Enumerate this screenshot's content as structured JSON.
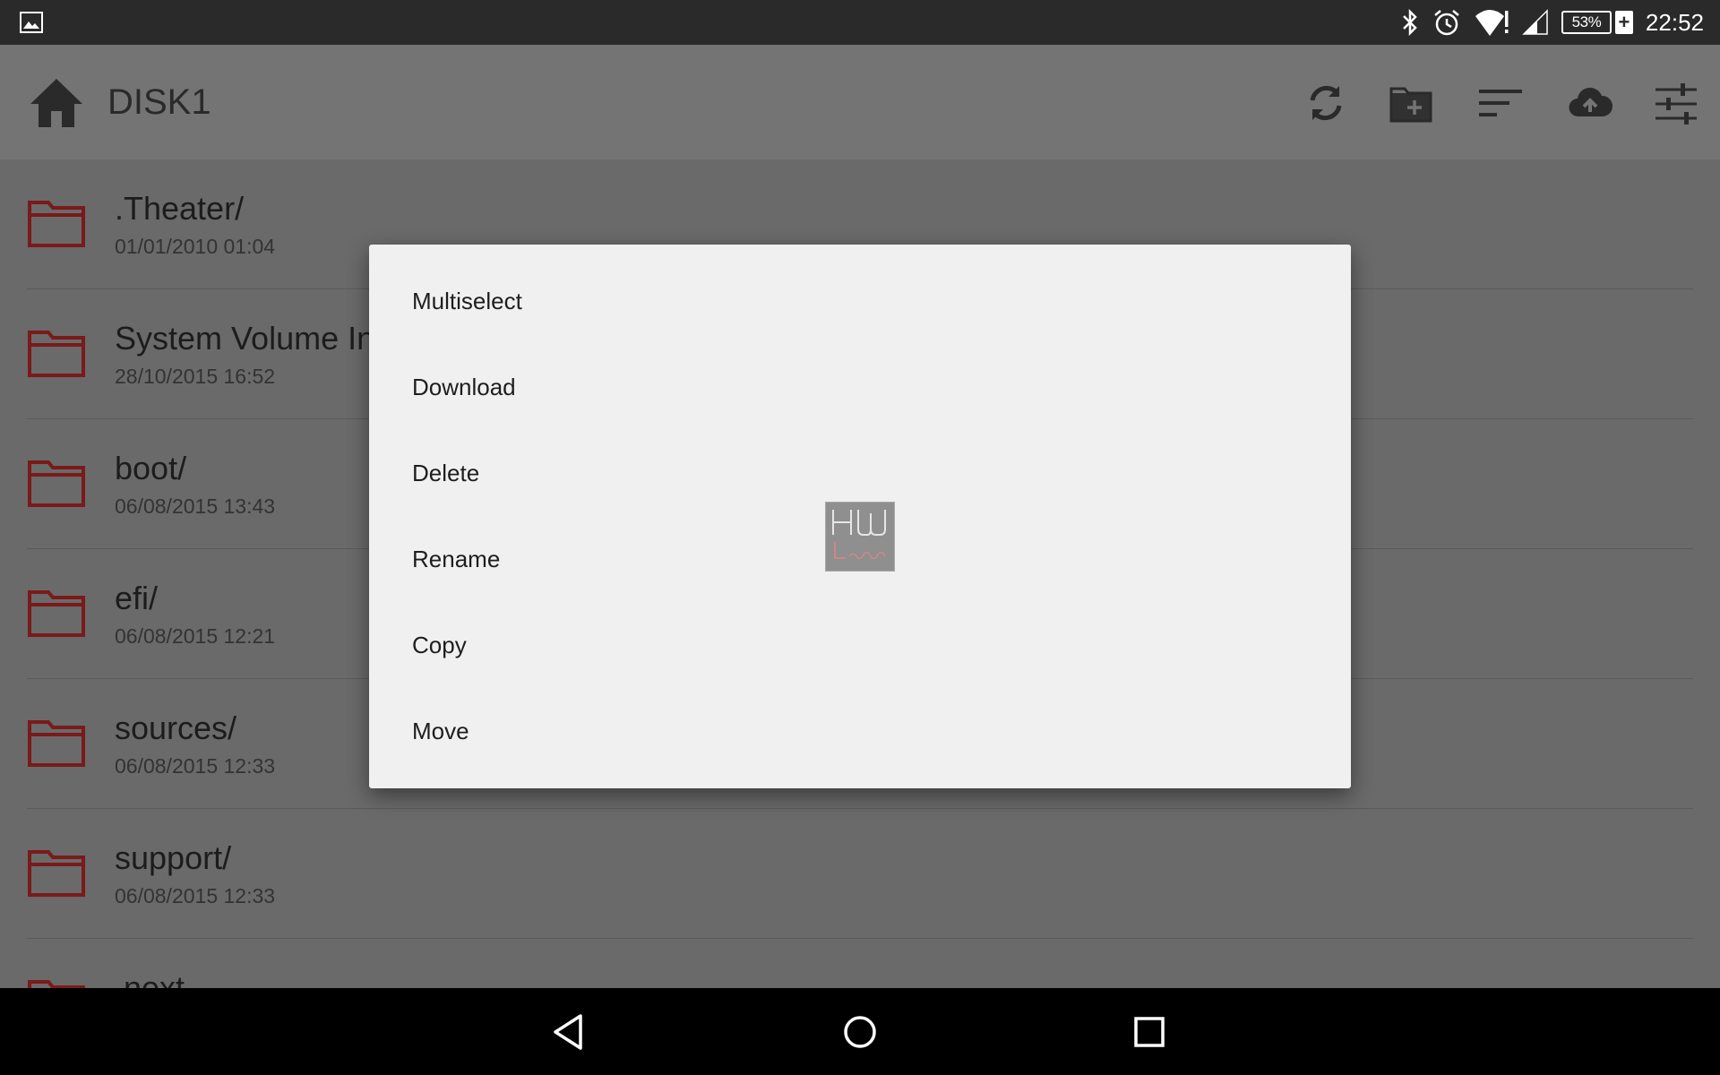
{
  "status_bar": {
    "time": "22:52",
    "battery_level": "53%",
    "icons": [
      "image-icon",
      "bluetooth-icon",
      "alarm-icon",
      "wifi-alert-icon",
      "cell-signal-icon",
      "battery-charging-icon"
    ]
  },
  "app_bar": {
    "title": "DISK1",
    "actions": [
      "refresh-icon",
      "new-folder-icon",
      "sort-icon",
      "upload-icon",
      "settings-sliders-icon"
    ]
  },
  "files": [
    {
      "name": ".Theater/",
      "date": "01/01/2010 01:04"
    },
    {
      "name": "System Volume In",
      "date": "28/10/2015 16:52"
    },
    {
      "name": "boot/",
      "date": "06/08/2015 13:43"
    },
    {
      "name": "efi/",
      "date": "06/08/2015 12:21"
    },
    {
      "name": "sources/",
      "date": "06/08/2015 12:33"
    },
    {
      "name": "support/",
      "date": "06/08/2015 12:33"
    },
    {
      "name": ".next",
      "date": ""
    }
  ],
  "context_menu": {
    "items": [
      "Multiselect",
      "Download",
      "Delete",
      "Rename",
      "Copy",
      "Move"
    ]
  },
  "watermark": {
    "text": "HW",
    "subtext": "Legend"
  },
  "colors": {
    "folder_accent": "#7a1a1a",
    "dialog_bg": "#f0f0f0",
    "scrim": "#6a6a6a"
  }
}
